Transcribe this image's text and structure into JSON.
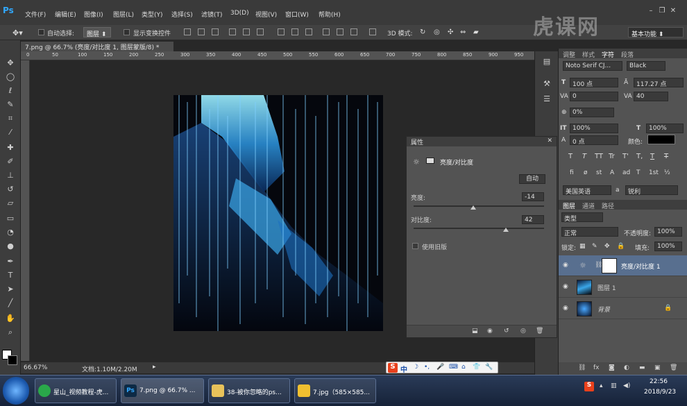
{
  "app": {
    "logo": "Ps"
  },
  "menu": [
    "文件(F)",
    "编辑(E)",
    "图像(I)",
    "图层(L)",
    "类型(Y)",
    "选择(S)",
    "滤镜(T)",
    "3D(D)",
    "视图(V)",
    "窗口(W)",
    "帮助(H)"
  ],
  "options": {
    "auto_select_label": "自动选择:",
    "auto_select_value": "图层",
    "show_transform_label": "显示变换控件",
    "mode_3d_label": "3D 模式:",
    "workspace": "基本功能"
  },
  "watermark": "虎课网",
  "document": {
    "tab_title": "7.png @ 66.7% (亮度/对比度 1, 图层蒙版/8) *",
    "ruler_marks": [
      "0",
      "50",
      "100",
      "150",
      "200",
      "250",
      "300",
      "350",
      "400",
      "450",
      "500",
      "550",
      "600",
      "650",
      "700",
      "750",
      "800",
      "850",
      "900",
      "950"
    ],
    "zoom": "66.67%",
    "doc_size": "文档:1.10M/2.20M"
  },
  "properties": {
    "panel_tab": "属性",
    "adjust_title": "亮度/对比度",
    "auto_button": "自动",
    "brightness_label": "亮度:",
    "brightness_value": "-14",
    "contrast_label": "对比度:",
    "contrast_value": "42",
    "legacy_label": "使用旧版",
    "brightness_level": 0.46,
    "contrast_level": 0.71
  },
  "character_panel": {
    "tabs": [
      "调整",
      "样式",
      "字符",
      "段落"
    ],
    "font_family": "Noto Serif CJ...",
    "font_style": "Black",
    "font_size": "100 点",
    "leading": "117.27 点",
    "kerning": "0",
    "tracking": "40",
    "tsume": "0%",
    "vertical_scale": "100%",
    "horizontal_scale": "100%",
    "baseline": "0 点",
    "color_label": "颜色:",
    "style_buttons": [
      "T",
      "T",
      "TT",
      "Tr",
      "T'",
      "T,",
      "T",
      "T"
    ],
    "opentype_buttons": [
      "fi",
      "ø",
      "st",
      "A",
      "ad",
      "T",
      "1st",
      "½"
    ],
    "language": "美国英语",
    "aa_label": "a",
    "antialias": "锐利"
  },
  "layers_panel": {
    "tabs": [
      "图层",
      "通道",
      "路径"
    ],
    "filter": "类型",
    "blend_mode": "正常",
    "opacity_label": "不透明度:",
    "opacity": "100%",
    "lock_label": "锁定:",
    "fill_label": "填充:",
    "fill": "100%",
    "layers": [
      {
        "name": "亮度/对比度 1",
        "selected": true
      },
      {
        "name": "图层 1",
        "selected": false
      },
      {
        "name": "背景",
        "selected": false
      }
    ]
  },
  "ime": {
    "label": "中"
  },
  "taskbar": {
    "items": [
      "星山_视频教程-虎...",
      "7.png @ 66.7% ...",
      "38-被你忽略的ps...",
      "7.jpg（585×585..."
    ],
    "time": "22:56",
    "date": "2018/9/23"
  },
  "colors": {
    "accent": "#31a8ff",
    "selected_layer": "#586f8f",
    "panel_bg": "#535353"
  }
}
